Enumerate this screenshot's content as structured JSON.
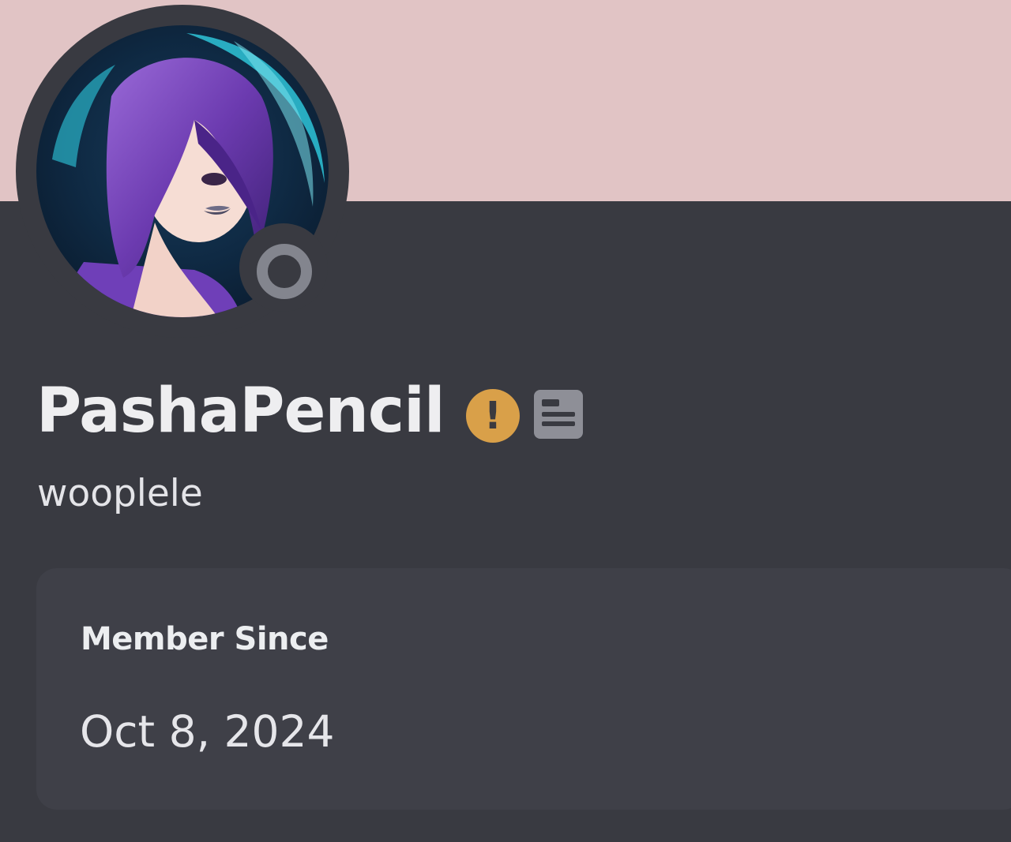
{
  "profile": {
    "display_name": "PashaPencil",
    "username": "wooplele",
    "status": "offline",
    "badges": [
      {
        "icon": "exclamation-circle-icon",
        "glyph": "!",
        "color": "#d9a049"
      },
      {
        "icon": "id-card-icon",
        "color": "#8e8f97"
      }
    ]
  },
  "colors": {
    "banner": "#e1c4c5",
    "background": "#393a41",
    "card": "#3f4048"
  },
  "member_since": {
    "label": "Member Since",
    "date": "Oct 8, 2024"
  }
}
